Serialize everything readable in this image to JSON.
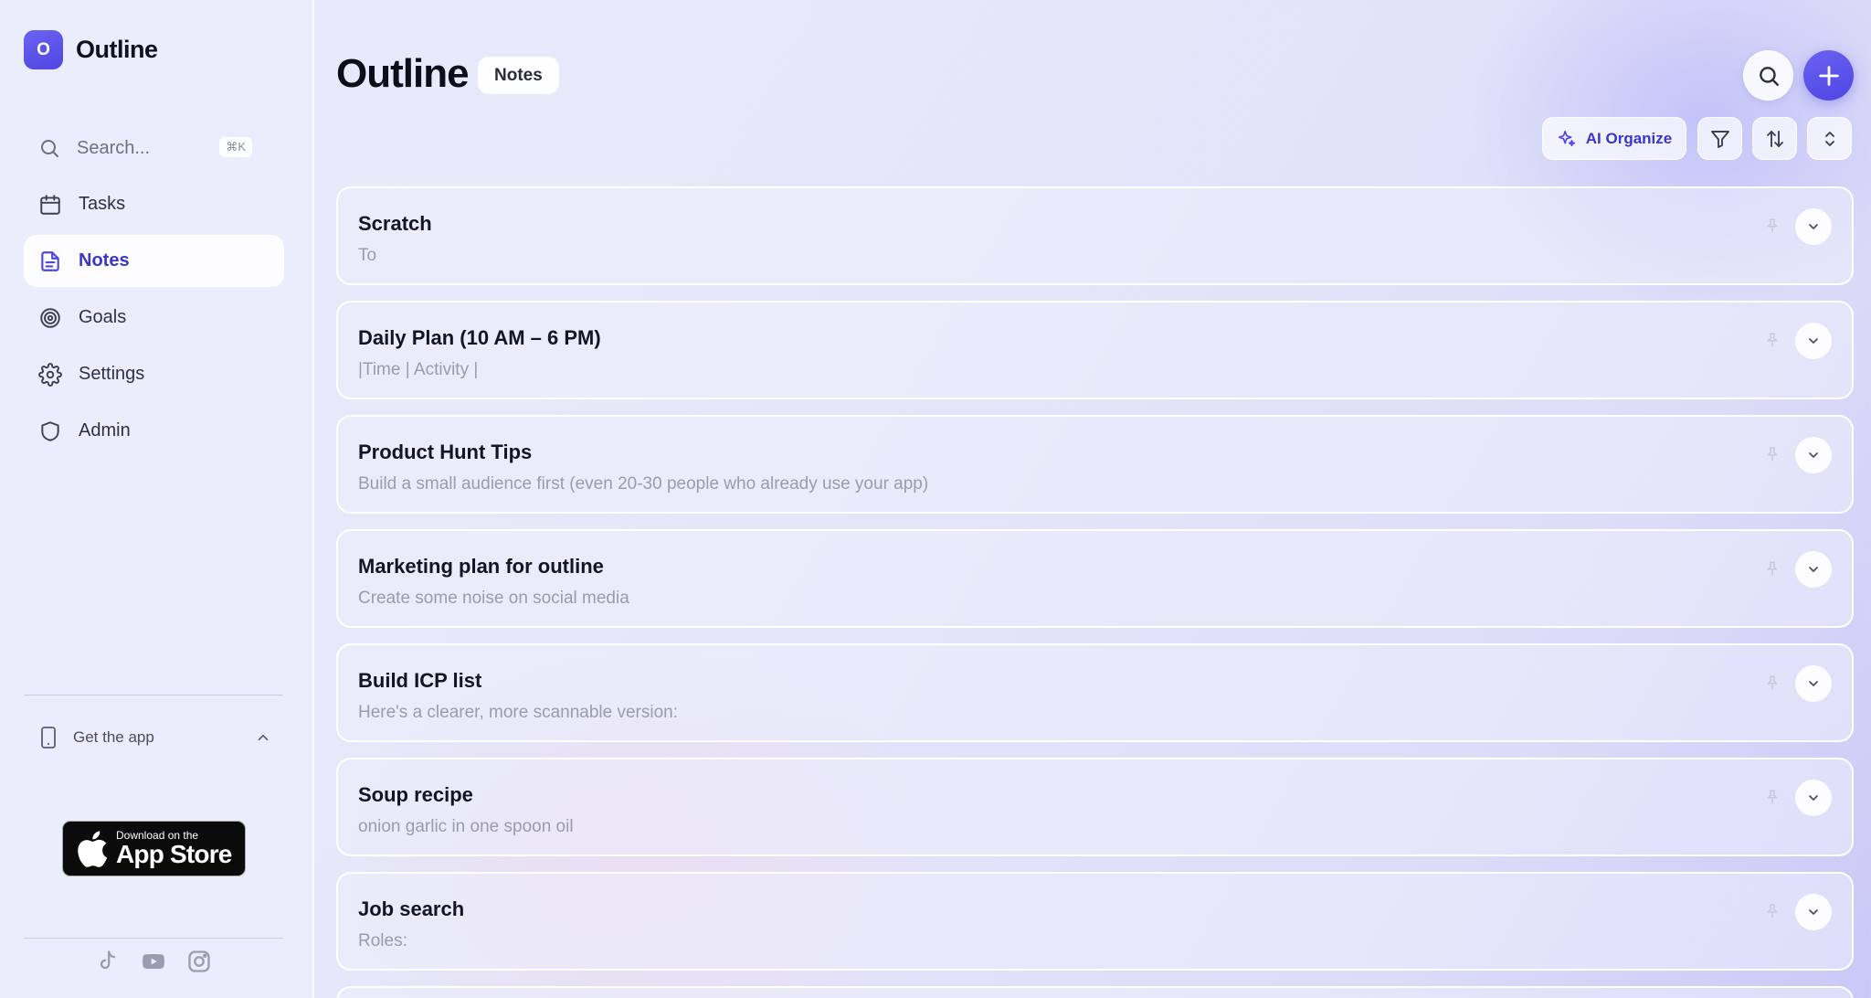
{
  "app": {
    "name": "Outline",
    "logo_letter": "O",
    "accent": "#4f46e5"
  },
  "sidebar": {
    "search": {
      "placeholder": "Search...",
      "shortcut": "⌘K"
    },
    "items": [
      {
        "label": "Tasks",
        "icon": "calendar-icon"
      },
      {
        "label": "Notes",
        "icon": "note-icon",
        "active": true
      },
      {
        "label": "Goals",
        "icon": "target-icon"
      },
      {
        "label": "Settings",
        "icon": "gear-icon"
      },
      {
        "label": "Admin",
        "icon": "shield-icon"
      }
    ],
    "get_app": {
      "label": "Get the app"
    },
    "app_store": {
      "small": "Download on the",
      "big": "App Store"
    },
    "socials": [
      "tiktok-icon",
      "youtube-icon",
      "instagram-icon"
    ]
  },
  "main": {
    "title": "Outline",
    "pill": "Notes",
    "toolbar": {
      "ai_label": "AI Organize"
    },
    "notes": [
      {
        "title": "Scratch",
        "preview": "To"
      },
      {
        "title": "Daily Plan (10 AM – 6 PM)",
        "preview": "|Time | Activity |"
      },
      {
        "title": "Product Hunt Tips",
        "preview": "Build a small audience first (even 20-30 people who already use your app)"
      },
      {
        "title": "Marketing plan for outline",
        "preview": "Create some noise on social media"
      },
      {
        "title": "Build ICP list",
        "preview": "Here's a clearer, more scannable version:"
      },
      {
        "title": "Soup recipe",
        "preview": "onion garlic in one spoon oil"
      },
      {
        "title": "Job search",
        "preview": "Roles:"
      }
    ]
  }
}
